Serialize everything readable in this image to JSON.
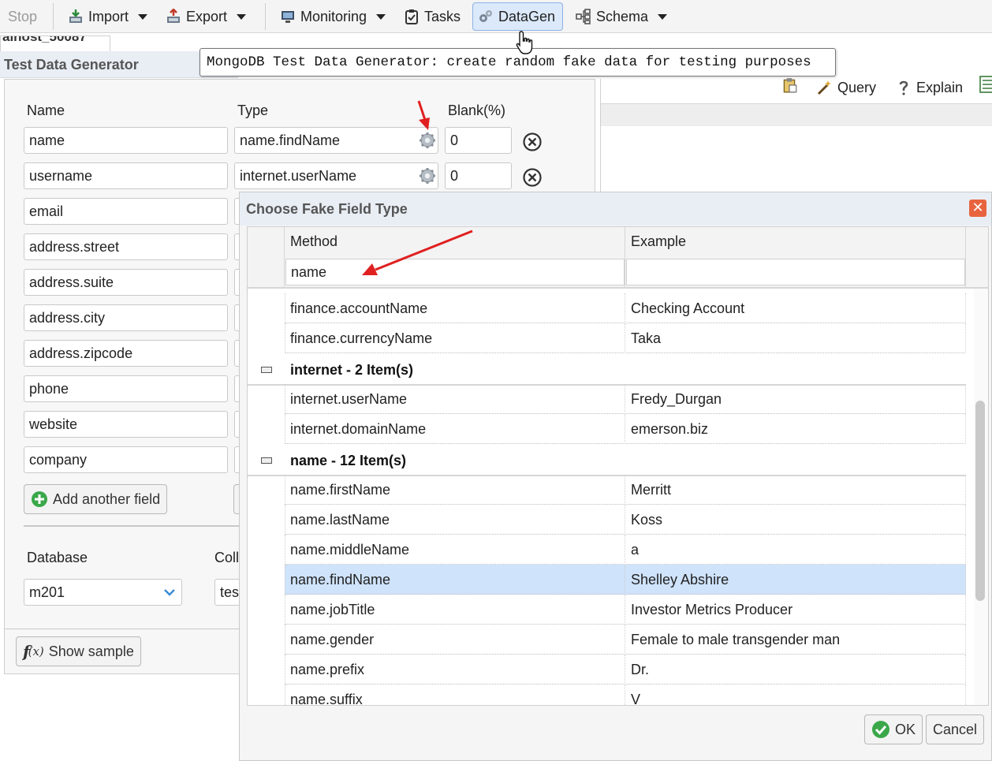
{
  "toolbar": {
    "stop_label": "Stop",
    "import_label": "Import",
    "export_label": "Export",
    "monitoring_label": "Monitoring",
    "tasks_label": "Tasks",
    "datagen_label": "DataGen",
    "schema_label": "Schema"
  },
  "tooltip": {
    "text": "MongoDB Test Data Generator: create random fake data for testing purposes"
  },
  "query_toolbar": {
    "query_label": "Query",
    "explain_label": "Explain"
  },
  "connection_tab": {
    "label": "alhost_50087"
  },
  "panel": {
    "title": "Test Data Generator",
    "headers": {
      "name": "Name",
      "type": "Type",
      "blank": "Blank(%)"
    },
    "fields": [
      {
        "name": "name",
        "type": "name.findName",
        "blank": "0"
      },
      {
        "name": "username",
        "type": "internet.userName",
        "blank": "0"
      },
      {
        "name": "email"
      },
      {
        "name": "address.street"
      },
      {
        "name": "address.suite"
      },
      {
        "name": "address.city"
      },
      {
        "name": "address.zipcode"
      },
      {
        "name": "phone"
      },
      {
        "name": "website"
      },
      {
        "name": "company"
      }
    ],
    "add_field_label": "Add another field",
    "database_label": "Database",
    "collection_label": "Coll",
    "database_value": "m201",
    "collection_value": "tes",
    "show_sample_label": "Show sample"
  },
  "dialog": {
    "title": "Choose Fake Field Type",
    "columns": {
      "method": "Method",
      "example": "Example"
    },
    "filter_value": "name",
    "rows_top": [
      {
        "method": "finance.accountName",
        "example": "Checking Account"
      },
      {
        "method": "finance.currencyName",
        "example": "Taka"
      }
    ],
    "group_internet": "internet - 2 Item(s)",
    "rows_internet": [
      {
        "method": "internet.userName",
        "example": "Fredy_Durgan"
      },
      {
        "method": "internet.domainName",
        "example": "emerson.biz"
      }
    ],
    "group_name": "name - 12 Item(s)",
    "rows_name": [
      {
        "method": "name.firstName",
        "example": "Merritt"
      },
      {
        "method": "name.lastName",
        "example": "Koss"
      },
      {
        "method": "name.middleName",
        "example": "a"
      },
      {
        "method": "name.findName",
        "example": "Shelley Abshire"
      },
      {
        "method": "name.jobTitle",
        "example": "Investor Metrics Producer"
      },
      {
        "method": "name.gender",
        "example": "Female to male transgender man"
      },
      {
        "method": "name.prefix",
        "example": "Dr."
      },
      {
        "method": "name.suffix",
        "example": "V"
      }
    ],
    "ok_label": "OK",
    "cancel_label": "Cancel"
  },
  "colors": {
    "accent": "#dbe9fb",
    "selection": "#cfe3fb",
    "close": "#e8643f",
    "annotation": "#e02020"
  }
}
